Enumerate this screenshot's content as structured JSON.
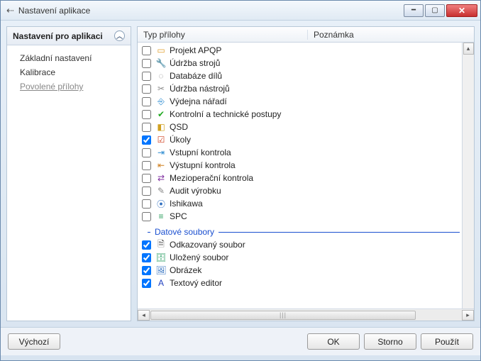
{
  "window": {
    "title": "Nastavení aplikace"
  },
  "sidebar": {
    "header": "Nastavení pro aplikaci",
    "items": [
      {
        "label": "Základní nastavení",
        "active": false
      },
      {
        "label": "Kalibrace",
        "active": false
      },
      {
        "label": "Povolené přílohy",
        "active": true
      }
    ]
  },
  "columns": {
    "col1": "Typ přílohy",
    "col2": "Poznámka"
  },
  "rows": [
    {
      "checked": false,
      "icon": "project-icon",
      "glyph": "▭",
      "color": "#e0a030",
      "label": "Projekt APQP"
    },
    {
      "checked": false,
      "icon": "maintenance-icon",
      "glyph": "🔧",
      "color": "#4a8",
      "label": "Údržba strojů"
    },
    {
      "checked": false,
      "icon": "database-icon",
      "glyph": "◌",
      "color": "#888",
      "label": "Databáze dílů"
    },
    {
      "checked": false,
      "icon": "tools-icon",
      "glyph": "✂",
      "color": "#888",
      "label": "Údržba nástrojů"
    },
    {
      "checked": false,
      "icon": "issue-icon",
      "glyph": "⎆",
      "color": "#2a8ad0",
      "label": "Výdejna nářadí"
    },
    {
      "checked": false,
      "icon": "procedure-icon",
      "glyph": "✔",
      "color": "#2a2",
      "label": "Kontrolní a technické postupy"
    },
    {
      "checked": false,
      "icon": "qsd-icon",
      "glyph": "◧",
      "color": "#d0a020",
      "label": "QSD"
    },
    {
      "checked": true,
      "icon": "tasks-icon",
      "glyph": "☑",
      "color": "#d04020",
      "label": "Úkoly"
    },
    {
      "checked": false,
      "icon": "input-icon",
      "glyph": "⇥",
      "color": "#2a8ad0",
      "label": "Vstupní kontrola"
    },
    {
      "checked": false,
      "icon": "output-icon",
      "glyph": "⇤",
      "color": "#d08020",
      "label": "Výstupní kontrola"
    },
    {
      "checked": false,
      "icon": "interop-icon",
      "glyph": "⇄",
      "color": "#8030a0",
      "label": "Mezioperační kontrola"
    },
    {
      "checked": false,
      "icon": "audit-icon",
      "glyph": "✎",
      "color": "#888",
      "label": "Audit výrobku"
    },
    {
      "checked": false,
      "icon": "ishikawa-icon",
      "glyph": "⦿",
      "color": "#3070c0",
      "label": "Ishikawa"
    },
    {
      "checked": false,
      "icon": "spc-icon",
      "glyph": "≡",
      "color": "#30a060",
      "label": "SPC"
    }
  ],
  "group2": {
    "label": "Datové soubory"
  },
  "rows2": [
    {
      "checked": true,
      "icon": "linked-file-icon",
      "glyph": "🗎",
      "color": "#555",
      "label": "Odkazovaný soubor"
    },
    {
      "checked": true,
      "icon": "stored-file-icon",
      "glyph": "🗄",
      "color": "#4a7",
      "label": "Uložený soubor"
    },
    {
      "checked": true,
      "icon": "image-icon",
      "glyph": "🖼",
      "color": "#3070c0",
      "label": "Obrázek"
    },
    {
      "checked": true,
      "icon": "text-editor-icon",
      "glyph": "A",
      "color": "#2040c0",
      "label": "Textový editor"
    }
  ],
  "buttons": {
    "default": "Výchozí",
    "ok": "OK",
    "cancel": "Storno",
    "apply": "Použít"
  }
}
